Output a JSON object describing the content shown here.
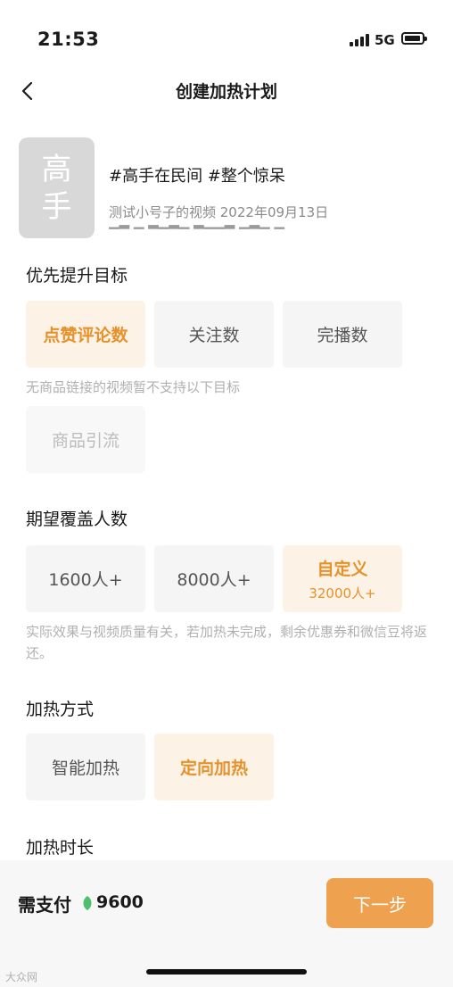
{
  "status_bar": {
    "time": "21:53",
    "network": "5G"
  },
  "header": {
    "title": "创建加热计划"
  },
  "video": {
    "thumb_line1": "高",
    "thumb_line2": "手",
    "title": "#高手在民间 #整个惊呆",
    "meta": "测试小号子的视频  2022年09月13日"
  },
  "goal": {
    "title": "优先提升目标",
    "options": [
      "点赞评论数",
      "关注数",
      "完播数"
    ],
    "selected_index": 0,
    "note": "无商品链接的视频暂不支持以下目标",
    "disabled_option": "商品引流"
  },
  "coverage": {
    "title": "期望覆盖人数",
    "options": [
      "1600人+",
      "8000人+"
    ],
    "custom_label": "自定义",
    "custom_value": "32000人+",
    "note": "实际效果与视频质量有关，若加热未完成，剩余优惠券和微信豆将返还。"
  },
  "method": {
    "title": "加热方式",
    "options": [
      "智能加热",
      "定向加热"
    ],
    "selected_index": 1
  },
  "duration": {
    "title": "加热时长"
  },
  "footer": {
    "pay_label": "需支付",
    "amount": "9600",
    "next_label": "下一步"
  },
  "watermark": "大众网"
}
